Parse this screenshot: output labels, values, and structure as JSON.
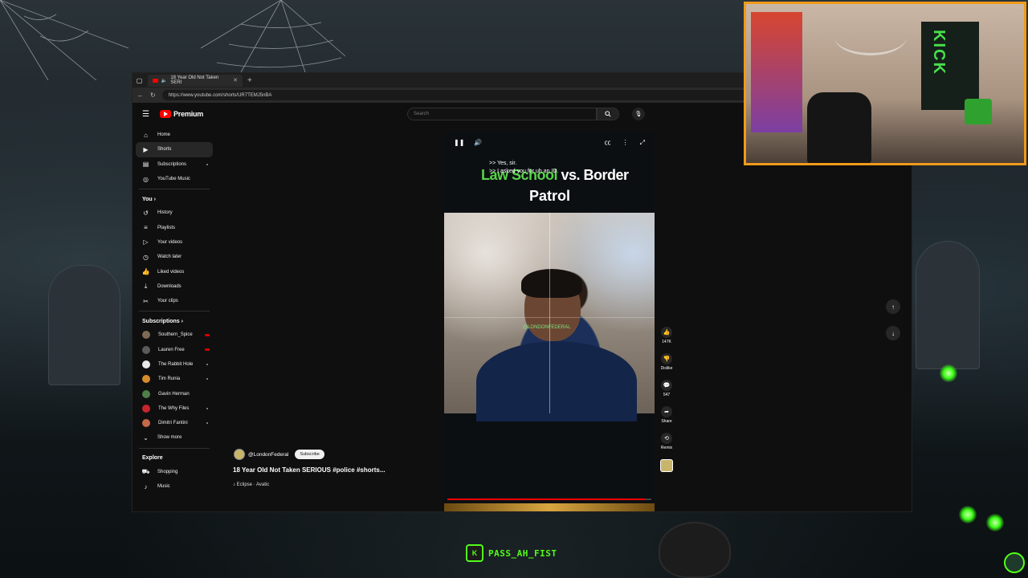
{
  "browser": {
    "tab_title": "18 Year Old Not Taken SERI",
    "url": "https://www.youtube.com/shorts/UR7TEMJ5nBA"
  },
  "header": {
    "logo_text": "Premium",
    "search_placeholder": "Search"
  },
  "sidebar": {
    "main": [
      {
        "label": "Home",
        "icon": "home-icon"
      },
      {
        "label": "Shorts",
        "icon": "shorts-icon"
      },
      {
        "label": "Subscriptions",
        "icon": "subscriptions-icon"
      },
      {
        "label": "YouTube Music",
        "icon": "music-icon"
      }
    ],
    "you_heading": "You",
    "you": [
      {
        "label": "History",
        "icon": "history-icon"
      },
      {
        "label": "Playlists",
        "icon": "playlists-icon"
      },
      {
        "label": "Your videos",
        "icon": "video-icon"
      },
      {
        "label": "Watch later",
        "icon": "clock-icon"
      },
      {
        "label": "Liked videos",
        "icon": "thumbs-up-icon"
      },
      {
        "label": "Downloads",
        "icon": "download-icon"
      },
      {
        "label": "Your clips",
        "icon": "scissors-icon"
      }
    ],
    "subs_heading": "Subscriptions",
    "subs": [
      {
        "label": "Southern_Spice",
        "color": "#7d6a55"
      },
      {
        "label": "Lauren Free",
        "color": "#5a5a5a"
      },
      {
        "label": "The Rabbit Hole",
        "color": "#e8e8e8"
      },
      {
        "label": "Tim Runia",
        "color": "#d88a2a"
      },
      {
        "label": "Gavin Herman",
        "color": "#4e7e4a"
      },
      {
        "label": "The Why Files",
        "color": "#c4262b"
      },
      {
        "label": "Dimitri Fantini",
        "color": "#c46a47"
      }
    ],
    "show_more": "Show more",
    "explore_heading": "Explore",
    "explore": [
      {
        "label": "Shopping",
        "icon": "shopping-icon"
      },
      {
        "label": "Music",
        "icon": "music-note-icon"
      }
    ]
  },
  "video": {
    "caption_line1": ">> Yes, sir.",
    "caption_line2": ">> I asked you for uh an ID.",
    "overlay_line1_green": "Law School",
    "overlay_line1_white": " vs. Border",
    "overlay_line2": "Patrol",
    "watermark": "@LONDONFEDERAL",
    "progress_fraction": 0.97
  },
  "channel": {
    "handle": "@LondonFederal",
    "subscribe": "Subscribe",
    "title": "18 Year Old Not Taken SERIOUS #police #shorts...",
    "music": "♪ Eclipse · Avatic"
  },
  "actions": {
    "likes": "147K",
    "dislike": "Dislike",
    "comments": "547",
    "share": "Share",
    "remix": "Remix"
  },
  "webcam": {
    "flag_text": "KICK"
  },
  "stream": {
    "handle": "PASS_AH_FIST",
    "accent": "#53fc18"
  }
}
